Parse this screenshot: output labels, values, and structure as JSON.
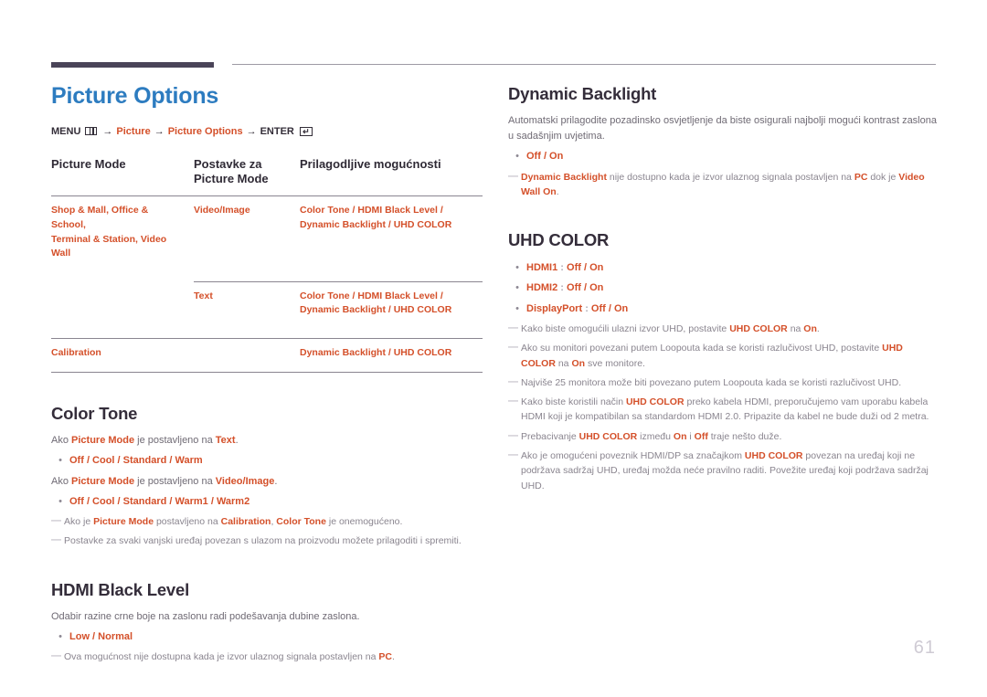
{
  "page": {
    "number": "61",
    "title": "Picture Options",
    "title_color": "#2d7cc0",
    "accent_color": "#d4502a",
    "heading_color": "#342d3a"
  },
  "menu_path": {
    "menu_label": "MENU",
    "menu_icon": "menu-bars-icon",
    "arrow": "→",
    "step1": "Picture",
    "step2": "Picture Options",
    "enter_label": "ENTER",
    "enter_icon": "enter-return-icon",
    "enter_glyph": "↵"
  },
  "table": {
    "headers": [
      "Picture Mode",
      "Postavke za\nPicture Mode",
      "Prilagodljive mogućnosti"
    ],
    "header_1": "Picture Mode",
    "header_2_line1": "Postavke za",
    "header_2_line2": "Picture Mode",
    "header_3": "Prilagodljive mogućnosti",
    "rows": [
      {
        "mode_line1": "Shop & Mall, Office & School,",
        "mode_line2": "Terminal & Station, Video Wall",
        "setting": "Video/Image",
        "options_line1": "Color Tone / HDMI Black Level /",
        "options_line2": "Dynamic Backlight / UHD COLOR"
      },
      {
        "mode_line1": "",
        "mode_line2": "",
        "setting": "Text",
        "options_line1": "Color Tone / HDMI Black Level /",
        "options_line2": "Dynamic Backlight / UHD COLOR"
      },
      {
        "mode_line1": "Calibration",
        "mode_line2": "",
        "setting": "",
        "options_line1": "Dynamic Backlight / UHD COLOR",
        "options_line2": ""
      }
    ]
  },
  "color_tone": {
    "title": "Color Tone",
    "para1_pre": "Ako ",
    "para1_k1": "Picture Mode",
    "para1_mid": " je postavljeno na ",
    "para1_k2": "Text",
    "para1_end": ".",
    "bullet1": "Off / Cool / Standard / Warm",
    "para2_pre": "Ako ",
    "para2_k1": "Picture Mode",
    "para2_mid": " je postavljeno na ",
    "para2_k2": "Video/Image",
    "para2_end": ".",
    "bullet2": "Off / Cool / Standard / Warm1 / Warm2",
    "note1_pre": "Ako je ",
    "note1_k1": "Picture Mode",
    "note1_mid": " postavljeno na ",
    "note1_k2": "Calibration",
    "note1_mid2": ", ",
    "note1_k3": "Color Tone",
    "note1_end": " je onemogućeno.",
    "note2": "Postavke za svaki vanjski uređaj povezan s ulazom na proizvodu možete prilagoditi i spremiti."
  },
  "hdmi_black_level": {
    "title": "HDMI Black Level",
    "para": "Odabir razine crne boje na zaslonu radi podešavanja dubine zaslona.",
    "bullet": "Low / Normal",
    "note_pre": "Ova mogućnost nije dostupna kada je izvor ulaznog signala postavljen na ",
    "note_k1": "PC",
    "note_end": "."
  },
  "dynamic_backlight": {
    "title": "Dynamic Backlight",
    "para": "Automatski prilagodite pozadinsko osvjetljenje da biste osigurali najbolji mogući kontrast zaslona u sadašnjim uvjetima.",
    "bullet": "Off / On",
    "note_k1": "Dynamic Backlight",
    "note_mid": " nije dostupno kada je izvor ulaznog signala postavljen na ",
    "note_k2": "PC",
    "note_mid2": " dok je ",
    "note_k3": "Video Wall",
    "note_mid3": " ",
    "note_k4": "On",
    "note_end": "."
  },
  "uhd_color": {
    "title": "UHD COLOR",
    "bullets": [
      {
        "label": "HDMI1",
        "sep": " : ",
        "values": "Off / On"
      },
      {
        "label": "HDMI2",
        "sep": " : ",
        "values": "Off / On"
      },
      {
        "label": "DisplayPort",
        "sep": " : ",
        "values": "Off / On"
      }
    ],
    "note1_pre": "Kako biste omogućili ulazni izvor UHD, postavite ",
    "note1_k1": "UHD COLOR",
    "note1_mid": " na ",
    "note1_k2": "On",
    "note1_end": ".",
    "note2_pre": "Ako su monitori povezani putem Loopouta kada se koristi razlučivost UHD, postavite ",
    "note2_k1": "UHD COLOR",
    "note2_mid": " na ",
    "note2_k2": "On",
    "note2_end": " sve monitore.",
    "note3": "Najviše 25 monitora može biti povezano putem Loopouta kada se koristi razlučivost UHD.",
    "note4_pre": "Kako biste koristili način ",
    "note4_k1": "UHD COLOR",
    "note4_end": " preko kabela HDMI, preporučujemo vam uporabu kabela HDMI koji je kompatibilan sa standardom HDMI 2.0.  Pripazite da kabel ne bude duži od 2 metra.",
    "note5_pre": "Prebacivanje ",
    "note5_k1": "UHD COLOR",
    "note5_mid": " između ",
    "note5_k2": "On",
    "note5_mid2": " i ",
    "note5_k3": "Off",
    "note5_end": " traje nešto duže.",
    "note6_pre": "Ako je omogućeni poveznik HDMI/DP sa značajkom ",
    "note6_k1": "UHD COLOR",
    "note6_end": " povezan na uređaj koji ne podržava sadržaj UHD, uređaj možda neće pravilno raditi. Povežite uređaj koji podržava sadržaj UHD."
  }
}
